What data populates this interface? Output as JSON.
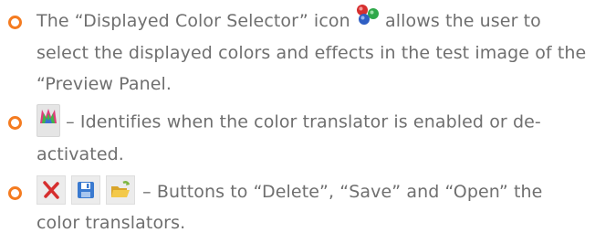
{
  "colors": {
    "text": "#6f6f6f",
    "bullet": "#f47b20",
    "delete_red": "#d62f2f",
    "save_blue": "#3a7ad0",
    "folder_yellow": "#e9b93a",
    "folder_green": "#7db541"
  },
  "items": [
    {
      "text_before_icon": "The “Displayed Color Selector” icon",
      "icon": "color-balls-icon",
      "text_after_icon": " allows the user to select the displayed colors and effects in the test image of the “Preview Panel."
    },
    {
      "icon": "color-translator-status-icon",
      "text_after_icon": " – Identifies when the color translator is enabled or de-activated."
    },
    {
      "icons": [
        "delete-icon",
        "save-icon",
        "open-folder-icon"
      ],
      "text_after_icon": " – Buttons to “Delete”, “Save” and “Open” the color translators."
    }
  ]
}
